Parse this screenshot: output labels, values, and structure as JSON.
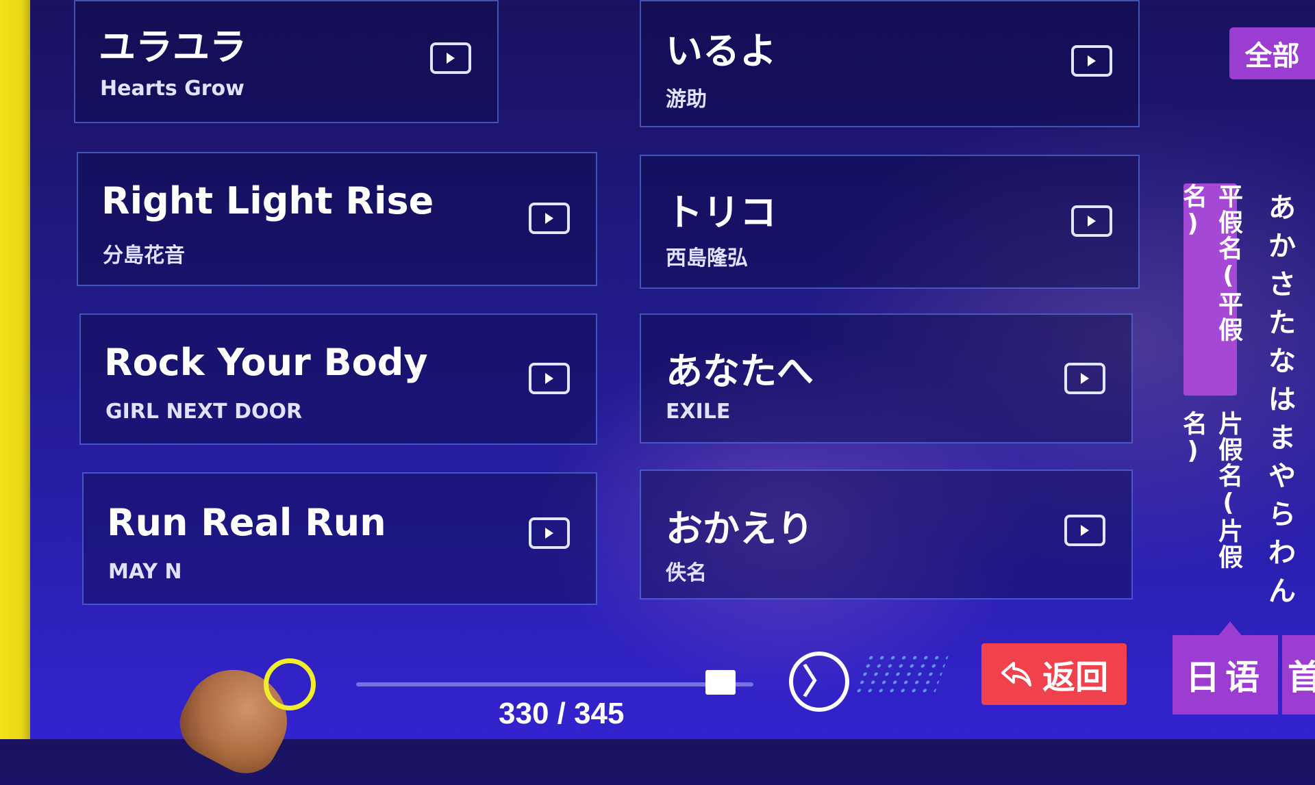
{
  "songs": [
    {
      "title": "ユラユラ",
      "artist": "Hearts Grow"
    },
    {
      "title": "いるよ",
      "artist": "游助"
    },
    {
      "title": "Right Light Rise",
      "artist": "分島花音"
    },
    {
      "title": "トリコ",
      "artist": "西島隆弘"
    },
    {
      "title": "Rock Your Body",
      "artist": "GIRL NEXT DOOR"
    },
    {
      "title": "あなたへ",
      "artist": "EXILE"
    },
    {
      "title": "Run Real Run",
      "artist": "MAY N"
    },
    {
      "title": "おかえり",
      "artist": "佚名"
    }
  ],
  "pagination": {
    "indicator": "330 / 345",
    "current": 330,
    "total": 345
  },
  "footer": {
    "back_label": "返回",
    "next_symbol": "〉"
  },
  "sidebar": {
    "all_label": "全部",
    "tab_hiragana": "平假名(平假名)",
    "tab_katakana": "片假名(片假名)",
    "kana_index": [
      "あ",
      "か",
      "さ",
      "た",
      "な",
      "は",
      "ま",
      "や",
      "ら",
      "わ",
      "ん"
    ],
    "language_tab": "日语",
    "language_tab_2": "首"
  },
  "icons": {
    "play": "play-video-icon",
    "back": "back-arrow-icon",
    "next": "next-page-icon"
  },
  "colors": {
    "back_button": "#f0414c",
    "tab_active": "#9a3dd0",
    "card_border": "#6a8cff"
  }
}
